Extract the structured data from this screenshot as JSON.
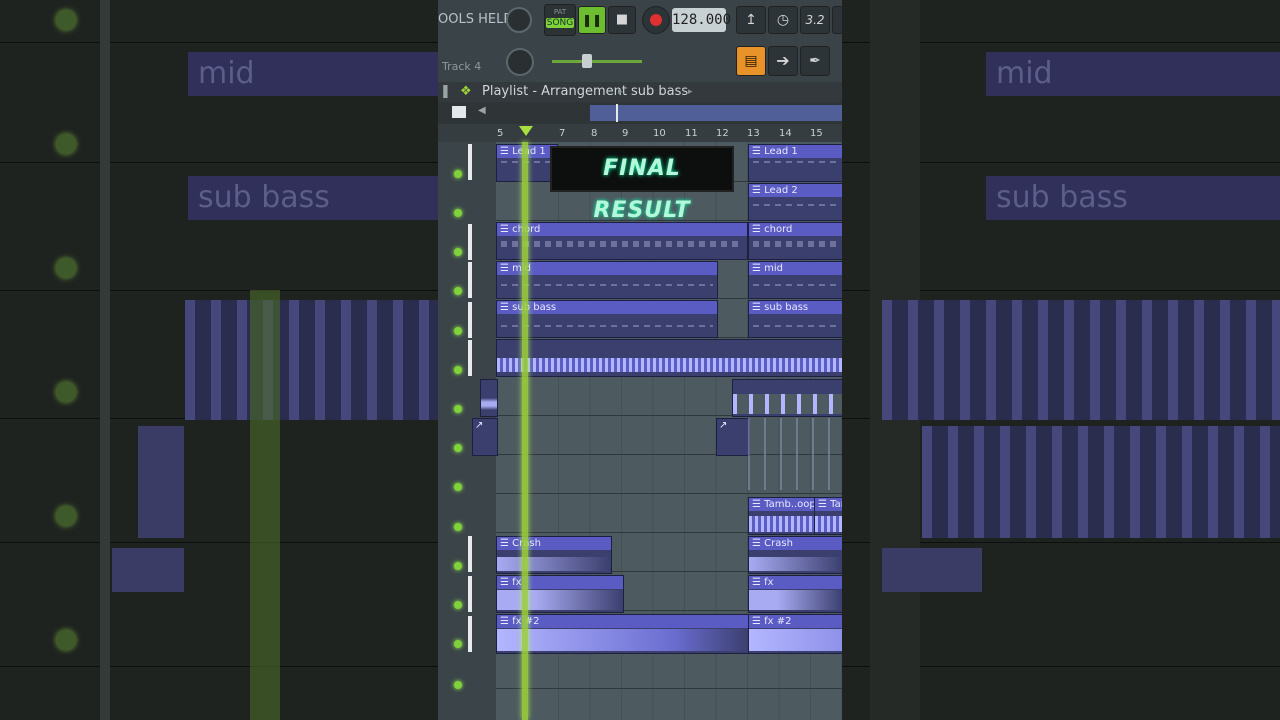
{
  "toolbar": {
    "menu_tools_help": "OOLS HELP",
    "pat_label": "PAT",
    "song_label": "SONG",
    "tempo": "128.000",
    "track_label": "Track 4",
    "time_sig": "3.2"
  },
  "breadcrumb": {
    "path": "Playlist - Arrangement",
    "current": "sub bass"
  },
  "ruler": {
    "bars": [
      "5",
      "7",
      "8",
      "9",
      "10",
      "11",
      "12",
      "13",
      "14",
      "15"
    ]
  },
  "overlay": {
    "text": "FINAL RESULT"
  },
  "clips": {
    "lead1_a": "Lead 1",
    "lead1_b": "Lead 1",
    "lead2": "Lead 2",
    "chord_a": "chord",
    "chord_b": "chord",
    "mid_a": "mid",
    "mid_b": "mid",
    "subbass_a": "sub bass",
    "subbass_b": "sub bass",
    "tamb_a": "Tamb..oop",
    "tamb_b": "Tam",
    "crash_a": "Crash",
    "crash_b": "Crash",
    "fx_a": "fx",
    "fx_b": "fx",
    "fx2_a": "fx #2",
    "fx2_b": "fx #2"
  },
  "background_blur": {
    "mid": "mid",
    "sub_bass": "sub bass"
  },
  "colors": {
    "clip_header": "#5a5cc4",
    "clip_body": "#3b3f6e",
    "playhead": "#9fd23a",
    "grid": "#4d5a5f"
  }
}
